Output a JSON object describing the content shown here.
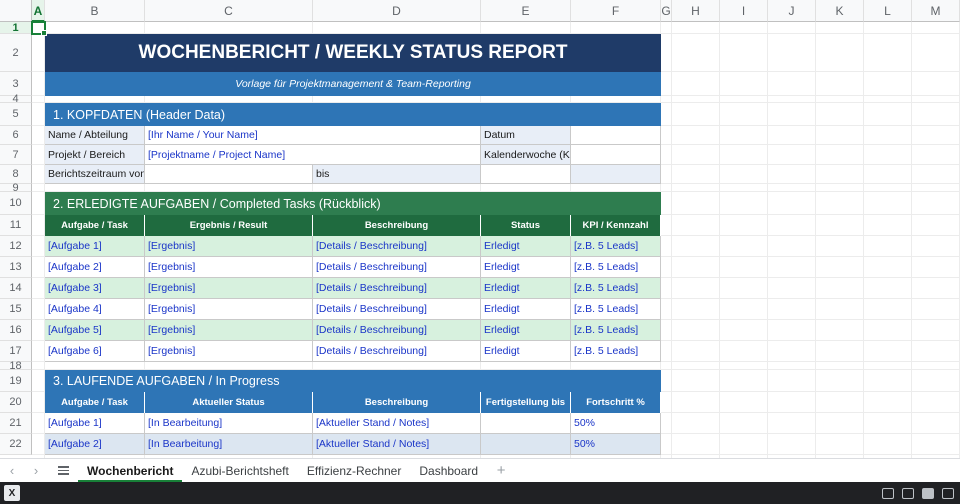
{
  "spreadsheet": {
    "columns": [
      "A",
      "B",
      "C",
      "D",
      "E",
      "F",
      "G",
      "H",
      "I",
      "J",
      "K",
      "L",
      "M"
    ],
    "rows": [
      "1",
      "2",
      "3",
      "4",
      "5",
      "6",
      "7",
      "8",
      "9",
      "10",
      "11",
      "12",
      "13",
      "14",
      "15",
      "16",
      "17",
      "18",
      "19",
      "20",
      "21",
      "22"
    ],
    "selected_cell": "A1"
  },
  "report": {
    "title": "WOCHENBERICHT / WEEKLY STATUS REPORT",
    "subtitle": "Vorlage für Projektmanagement & Team-Reporting",
    "header_section": {
      "heading": "1. KOPFDATEN (Header Data)",
      "name_label": "Name / Abteilung",
      "name_value": "[Ihr Name / Your Name]",
      "date_label": "Datum",
      "project_label": "Projekt / Bereich",
      "project_value": "[Projektname / Project Name]",
      "week_label": "Kalenderwoche (K",
      "period_label": "Berichtszeitraum von",
      "period_to_label": "bis"
    },
    "completed": {
      "heading": "2. ERLEDIGTE AUFGABEN / Completed Tasks  (Rückblick)",
      "columns": [
        "Aufgabe / Task",
        "Ergebnis / Result",
        "Beschreibung",
        "Status",
        "KPI / Kennzahl"
      ],
      "rows": [
        [
          "[Aufgabe 1]",
          "[Ergebnis]",
          "[Details / Beschreibung]",
          "Erledigt",
          "[z.B. 5 Leads]"
        ],
        [
          "[Aufgabe 2]",
          "[Ergebnis]",
          "[Details / Beschreibung]",
          "Erledigt",
          "[z.B. 5 Leads]"
        ],
        [
          "[Aufgabe 3]",
          "[Ergebnis]",
          "[Details / Beschreibung]",
          "Erledigt",
          "[z.B. 5 Leads]"
        ],
        [
          "[Aufgabe 4]",
          "[Ergebnis]",
          "[Details / Beschreibung]",
          "Erledigt",
          "[z.B. 5 Leads]"
        ],
        [
          "[Aufgabe 5]",
          "[Ergebnis]",
          "[Details / Beschreibung]",
          "Erledigt",
          "[z.B. 5 Leads]"
        ],
        [
          "[Aufgabe 6]",
          "[Ergebnis]",
          "[Details / Beschreibung]",
          "Erledigt",
          "[z.B. 5 Leads]"
        ]
      ]
    },
    "in_progress": {
      "heading": "3. LAUFENDE AUFGABEN / In Progress",
      "columns": [
        "Aufgabe / Task",
        "Aktueller Status",
        "Beschreibung",
        "Fertigstellung bis",
        "Fortschritt %"
      ],
      "rows": [
        [
          "[Aufgabe 1]",
          "[In Bearbeitung]",
          "[Aktueller Stand / Notes]",
          "",
          "50%"
        ],
        [
          "[Aufgabe 2]",
          "[In Bearbeitung]",
          "[Aktueller Stand / Notes]",
          "",
          "50%"
        ]
      ]
    }
  },
  "sheet_tabs": {
    "tabs": [
      "Wochenbericht",
      "Azubi-Berichtsheft",
      "Effizienz-Rechner",
      "Dashboard"
    ],
    "active": "Wochenbericht",
    "prev_glyph": "‹",
    "next_glyph": "›",
    "add_glyph": "+"
  },
  "statusbar": {
    "app_icon": "excel-icon",
    "app_icon_letter": "X"
  },
  "colors": {
    "title_band": "#1f3b68",
    "section_blue": "#2e75b6",
    "section_green": "#2e7d4f",
    "row_green": "#d7f1de",
    "row_blue": "#dce6f1",
    "selection": "#188038"
  }
}
